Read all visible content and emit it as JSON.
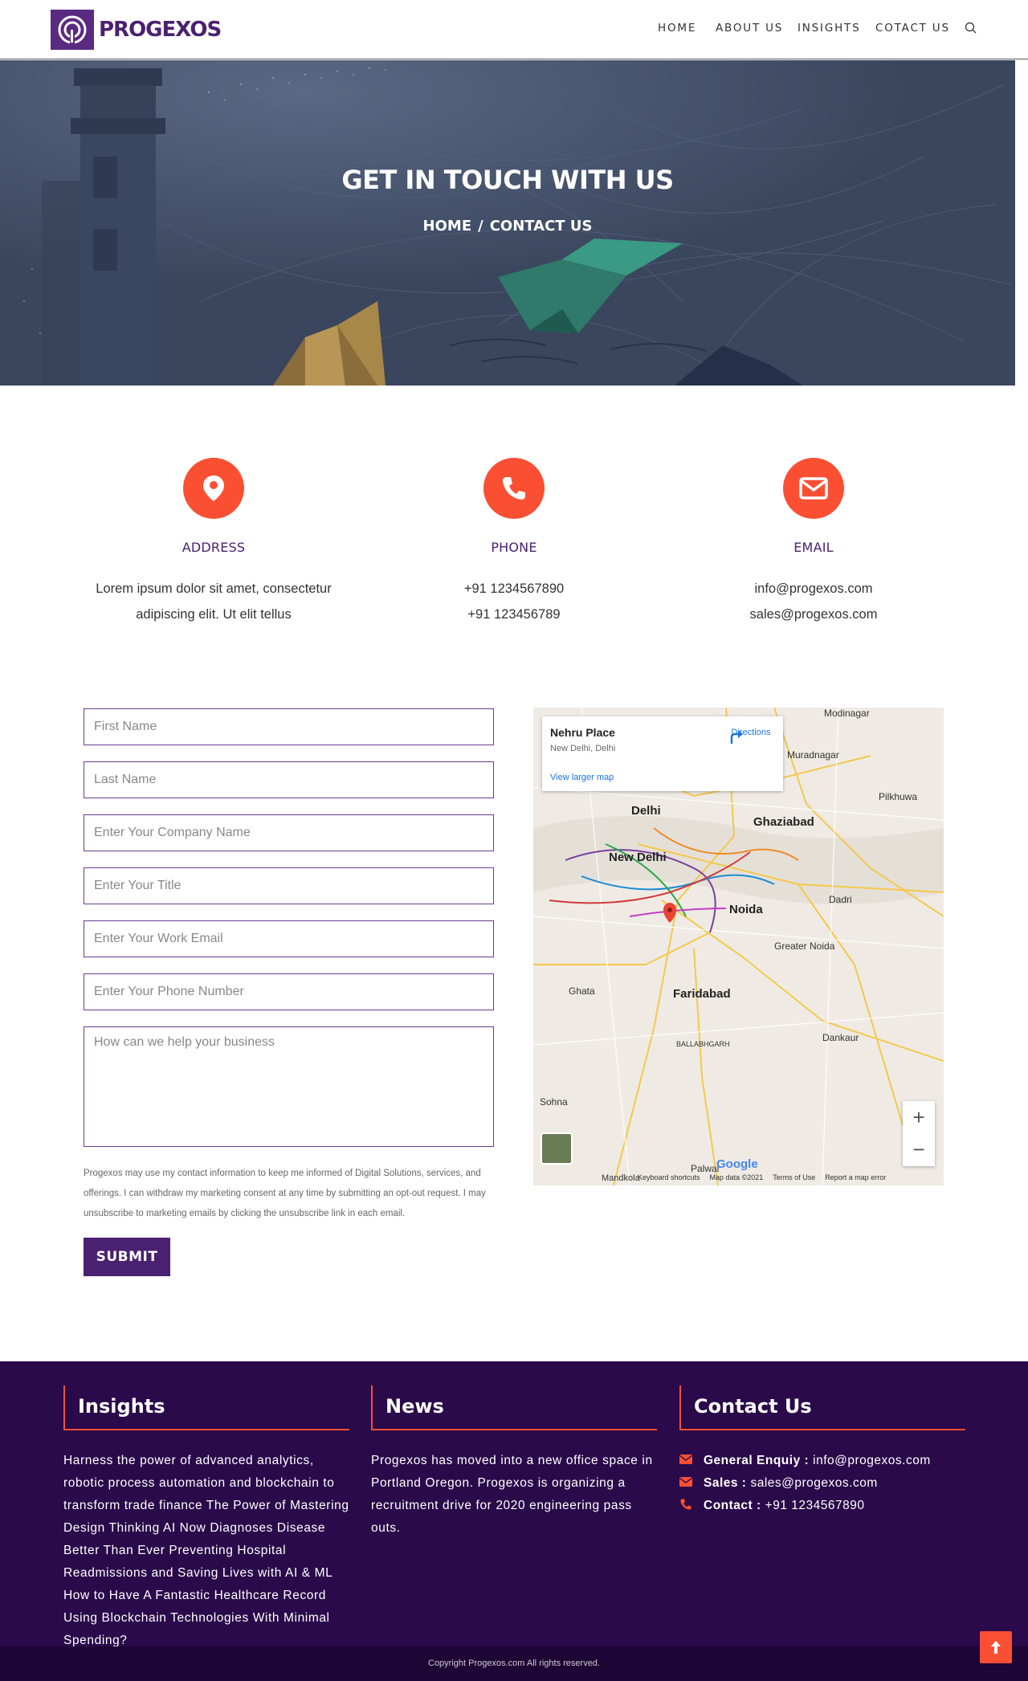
{
  "brand": {
    "name": "PROGEXOS",
    "color": "#4a2170",
    "accent": "#fb4f33"
  },
  "nav": {
    "items": [
      "HOME",
      "ABOUT US",
      "INSIGHTS",
      "COTACT US"
    ],
    "search_icon": "search-icon"
  },
  "hero": {
    "title": "GET IN TOUCH WITH US",
    "breadcrumb_home": "HOME",
    "breadcrumb_sep": "/",
    "breadcrumb_current": "CONTACT US"
  },
  "info": {
    "address": {
      "icon": "map-pin-icon",
      "heading": "ADDRESS",
      "line1": "Lorem ipsum dolor sit amet, consectetur",
      "line2": "adipiscing elit. Ut elit tellus"
    },
    "phone": {
      "icon": "phone-icon",
      "heading": "PHONE",
      "line1": "+91 1234567890",
      "line2": "+91 123456789"
    },
    "email": {
      "icon": "envelope-icon",
      "heading": "EMAIL",
      "line1": "info@progexos.com",
      "line2": "sales@progexos.com"
    }
  },
  "form": {
    "first_name": "First Name",
    "last_name": "Last Name",
    "company": "Enter Your Company Name",
    "title": "Enter Your Title",
    "work_email": "Enter Your Work Email",
    "phone": "Enter Your Phone Number",
    "message": "How can we help your business",
    "disclaimer": "Progexos may use my contact information to keep me informed of Digital Solutions, services, and offerings. I can withdraw my marketing consent at any time by submitting an opt-out request. I may unsubscribe to marketing emails by clicking the unsubscribe link in each email.",
    "submit": "SUBMIT"
  },
  "map": {
    "place": "Nehru Place",
    "place_sub": "New Delhi, Delhi",
    "directions": "Directions",
    "view_larger": "View larger map",
    "labels": {
      "modinagar": "Modinagar",
      "muradnagar": "Muradnagar",
      "pilkhuwa": "Pilkhuwa",
      "delhi": "Delhi",
      "ghaziabad": "Ghaziabad",
      "new_delhi": "New Delhi",
      "noida": "Noida",
      "dadri": "Dadri",
      "greater_noida": "Greater Noida",
      "faridabad": "Faridabad",
      "ghata": "Ghata",
      "ballabhgarh": "BALLABHGARH",
      "dankaur": "Dankaur",
      "sohna": "Sohna",
      "palwal": "Palwal",
      "mandkola": "Mandkola"
    },
    "zoom_in": "+",
    "zoom_out": "−",
    "google": "Google",
    "footer_shortcuts": "Keyboard shortcuts",
    "footer_data": "Map data ©2021",
    "footer_terms": "Terms of Use",
    "footer_report": "Report a map error"
  },
  "footer": {
    "insights_title": "Insights",
    "insights_text": "Harness the power of advanced analytics, robotic process automation and blockchain to transform trade finance The Power of Mastering Design Thinking AI Now Diagnoses Disease Better Than Ever Preventing Hospital Readmissions and Saving Lives with AI & ML How to Have A Fantastic Healthcare Record Using Blockchain Technologies With Minimal Spending?",
    "news_title": "News",
    "news_text": "Progexos has moved into a new office space in Portland Oregon. Progexos is organizing a recruitment drive for 2020 engineering pass outs.",
    "contact_title": "Contact Us",
    "general_label": "General Enquiy :",
    "general_value": "info@progexos.com",
    "sales_label": "Sales :",
    "sales_value": "sales@progexos.com",
    "contact_label": "Contact :",
    "contact_value": "+91 1234567890",
    "copyright": "Copyright Progexos.com All rights reserved."
  }
}
